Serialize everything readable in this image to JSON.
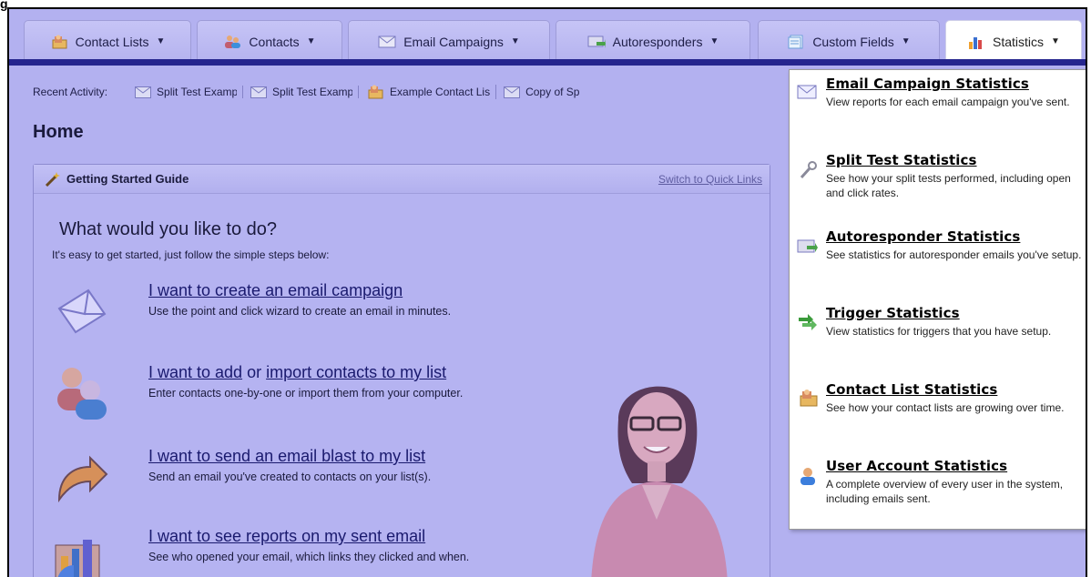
{
  "window": {
    "corner_label": "g"
  },
  "tabs": [
    {
      "label": "Contact Lists",
      "icon": "contact-lists-icon"
    },
    {
      "label": "Contacts",
      "icon": "contacts-icon"
    },
    {
      "label": "Email Campaigns",
      "icon": "email-icon"
    },
    {
      "label": "Autoresponders",
      "icon": "autoresponder-icon"
    },
    {
      "label": "Custom Fields",
      "icon": "custom-fields-icon"
    },
    {
      "label": "Statistics",
      "icon": "statistics-icon"
    }
  ],
  "recent": {
    "label": "Recent Activity:",
    "items": [
      {
        "label": "Split Test Example V",
        "icon": "email-icon"
      },
      {
        "label": "Split Test Example V",
        "icon": "email-icon"
      },
      {
        "label": "Example Contact Lis",
        "icon": "contact-lists-icon"
      },
      {
        "label": "Copy of Sp",
        "icon": "email-icon"
      }
    ]
  },
  "page": {
    "title": "Home"
  },
  "guide": {
    "title": "Getting Started Guide",
    "switch_link": "Switch to Quick Links",
    "question": "What would you like to do?",
    "subtitle": "It's easy to get started, just follow the simple steps below:",
    "steps": [
      {
        "link": "I want to create an email campaign",
        "desc": "Use the point and click wizard to create an email in minutes."
      },
      {
        "link_a": "I want to add",
        "middle": " or ",
        "link_b": "import contacts to my list",
        "desc": "Enter contacts one-by-one or import them from your computer."
      },
      {
        "link": "I want to send an email blast to my list",
        "desc": "Send an email you've created to contacts on your list(s)."
      },
      {
        "link": "I want to see reports on my sent email",
        "desc": "See who opened your email, which links they clicked and when."
      }
    ]
  },
  "statistics_menu": [
    {
      "title": "Email Campaign Statistics",
      "desc": "View reports for each email campaign you've sent.",
      "icon": "email-icon"
    },
    {
      "title": "Split Test Statistics",
      "desc": "See how your split tests performed, including open and click rates.",
      "icon": "split-test-icon"
    },
    {
      "title": "Autoresponder Statistics",
      "desc": "See statistics for autoresponder emails you've setup.",
      "icon": "autoresponder-icon"
    },
    {
      "title": "Trigger Statistics",
      "desc": "View statistics for triggers that you have setup.",
      "icon": "trigger-icon"
    },
    {
      "title": "Contact List Statistics",
      "desc": "See how your contact lists are growing over time.",
      "icon": "contact-lists-icon"
    },
    {
      "title": "User Account Statistics",
      "desc": "A complete overview of every user in the system, including emails sent.",
      "icon": "user-account-icon"
    }
  ],
  "colors": {
    "overlay": "#b3b1f0",
    "accent_bar": "#25258e",
    "link": "#1a1a6e"
  }
}
